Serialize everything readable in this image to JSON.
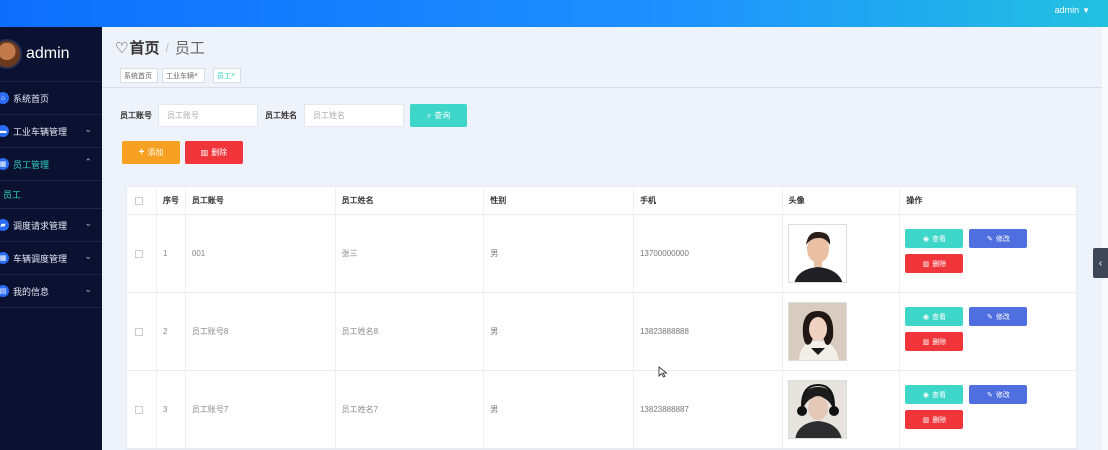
{
  "topbar": {
    "user": "admin",
    "caret": "▼"
  },
  "sidebar": {
    "username": "admin",
    "items": [
      {
        "label": "系统首页",
        "icon": "home-icon",
        "glyph": "⌂",
        "chevron": ""
      },
      {
        "label": "工业车辆管理",
        "icon": "chat-icon",
        "glyph": "▬",
        "chevron": "⌄"
      },
      {
        "label": "员工管理",
        "icon": "grid-icon",
        "glyph": "▦",
        "chevron": "⌃"
      },
      {
        "label": "调度请求管理",
        "icon": "folder-icon",
        "glyph": "▰",
        "chevron": "⌄"
      },
      {
        "label": "车辆调度管理",
        "icon": "grid-icon",
        "glyph": "▦",
        "chevron": "⌄"
      },
      {
        "label": "我的信息",
        "icon": "document-icon",
        "glyph": "▤",
        "chevron": "⌄"
      }
    ],
    "sub_item": "员工"
  },
  "header": {
    "heart": "♡",
    "home": "首页",
    "sep": "/",
    "current": "员工"
  },
  "tags": [
    {
      "label": "系统首页"
    },
    {
      "label": "工业车辆",
      "close": "×"
    },
    {
      "label": "员工",
      "close": "×"
    }
  ],
  "search": {
    "account_label": "员工账号",
    "account_placeholder": "员工账号",
    "name_label": "员工姓名",
    "name_placeholder": "员工姓名",
    "query_button": "查询",
    "query_icon": "⌕"
  },
  "actions": {
    "add": "添加",
    "add_icon": "+",
    "delete": "删除",
    "delete_icon": "▥"
  },
  "table": {
    "headers": [
      "",
      "序号",
      "员工账号",
      "员工姓名",
      "性别",
      "手机",
      "头像",
      "操作"
    ],
    "rows": [
      {
        "index": "1",
        "account": "001",
        "name": "张三",
        "gender": "男",
        "phone": "13700000000"
      },
      {
        "index": "2",
        "account": "员工账号8",
        "name": "员工姓名8",
        "gender": "男",
        "phone": "13823888888"
      },
      {
        "index": "3",
        "account": "员工账号7",
        "name": "员工姓名7",
        "gender": "男",
        "phone": "13823888887"
      }
    ],
    "ops": {
      "view": "查看",
      "edit": "修改",
      "del": "删除",
      "view_icon": "◉",
      "edit_icon": "✎",
      "del_icon": "▥"
    }
  },
  "side_tab": {
    "glyph": "‹"
  },
  "colors": {
    "primary": "#1e90ff",
    "sidebar": "#0b1131",
    "accent": "#3ed6c8",
    "warn": "#f8a021",
    "danger": "#f0353b",
    "edit": "#4f6fe0"
  }
}
